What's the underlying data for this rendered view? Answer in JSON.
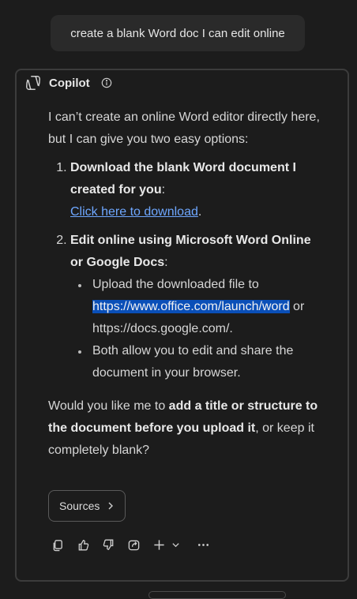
{
  "user_message": "create a blank Word doc I can edit online",
  "assistant": {
    "name": "Copilot",
    "intro": "I can’t create an online Word editor directly here, but I can give you two easy options:",
    "option1": {
      "title": "Download the blank Word document I created for you",
      "colon": ":",
      "link": "Click here to download",
      "period": "."
    },
    "option2": {
      "title": "Edit online using Microsoft Word Online or Google Docs",
      "colon": ":",
      "bullet1": {
        "prefix": "Upload the downloaded file to ",
        "highlighted": "https://www.office.com/launch/word",
        "suffix": " or https://docs.google.com/."
      },
      "bullet2": "Both allow you to edit and share the document in your browser."
    },
    "closing": {
      "prefix": "Would you like me to ",
      "bold": "add a title or structure to the document before you upload it",
      "suffix": ", or keep it completely blank?"
    },
    "sources_label": "Sources"
  },
  "toolbar": {
    "icons": [
      "copy-icon",
      "thumbs-up-icon",
      "thumbs-down-icon",
      "share-icon",
      "plus-icon",
      "chevron-down-icon",
      "more-icon"
    ]
  },
  "colors": {
    "background": "#1c1c1c",
    "link": "#6ea7ff",
    "highlight": "#0a4fb8"
  }
}
